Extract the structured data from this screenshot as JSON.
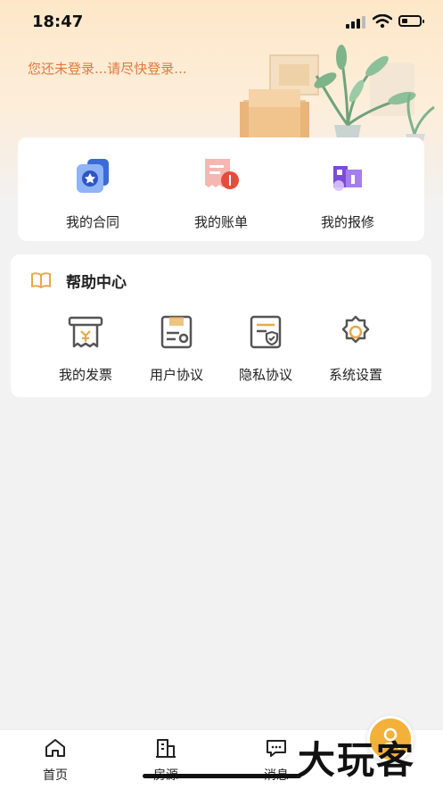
{
  "status_bar": {
    "time": "18:47"
  },
  "header": {
    "login_prompt": "您还未登录...请尽快登录..."
  },
  "quick_actions": [
    {
      "label": "我的合同",
      "icon": "contract-icon"
    },
    {
      "label": "我的账单",
      "icon": "bill-icon"
    },
    {
      "label": "我的报修",
      "icon": "repair-icon"
    }
  ],
  "help_center": {
    "title": "帮助中心",
    "items": [
      {
        "label": "我的发票",
        "icon": "invoice-icon"
      },
      {
        "label": "用户协议",
        "icon": "user-agreement-icon"
      },
      {
        "label": "隐私协议",
        "icon": "privacy-agreement-icon"
      },
      {
        "label": "系统设置",
        "icon": "settings-icon"
      }
    ]
  },
  "tab_bar": [
    {
      "label": "首页",
      "icon": "home-icon"
    },
    {
      "label": "房源",
      "icon": "building-icon"
    },
    {
      "label": "消息",
      "icon": "message-icon"
    }
  ],
  "watermark": "大玩客",
  "colors": {
    "accent": "#e07a40",
    "float_button": "#f3b13a"
  }
}
